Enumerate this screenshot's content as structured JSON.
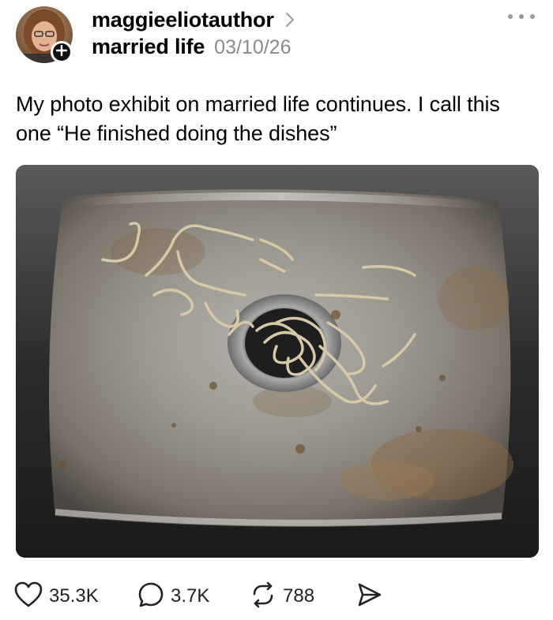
{
  "post": {
    "username": "maggieeliotauthor",
    "community": "married life",
    "date": "03/10/26",
    "text": "My photo exhibit on married life continues. I call this one “He finished doing the dishes”",
    "image_alt": "Stainless steel sink with leftover noodle strands around the drain"
  },
  "actions": {
    "likes": "35.3K",
    "comments": "3.7K",
    "reposts": "788"
  },
  "icons": {
    "follow": "plus-icon",
    "chevron": "chevron-right-icon",
    "more": "more-dots-icon",
    "like": "heart-icon",
    "comment": "comment-bubble-icon",
    "repost": "repost-icon",
    "share": "send-icon"
  }
}
